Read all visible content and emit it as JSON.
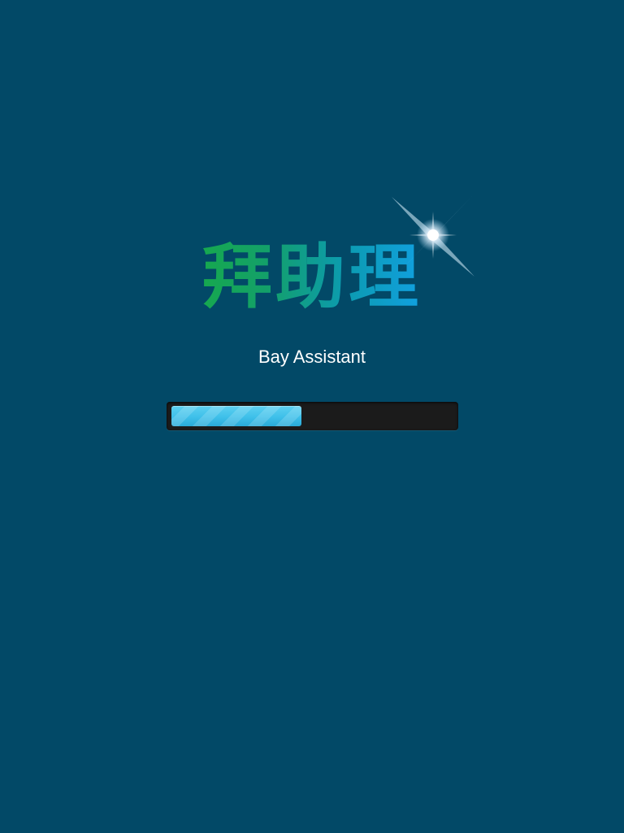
{
  "app": {
    "logo_text": "拜助理",
    "subtitle": "Bay Assistant"
  },
  "loading": {
    "progress_fraction": 0.46
  },
  "colors": {
    "background": "#024967",
    "logo_green": "#16a84f",
    "logo_blue": "#11a0e0",
    "progress_fill": "#3ec0ea",
    "progress_track": "#1b1b1b",
    "subtitle_text": "#ffffff"
  },
  "icons": {
    "sparkle": "sparkle-icon"
  }
}
